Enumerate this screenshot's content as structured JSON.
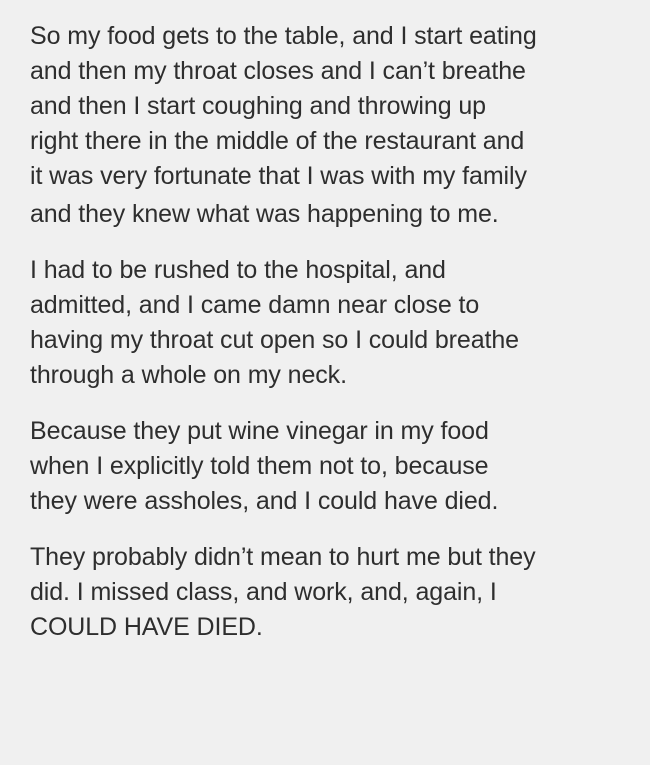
{
  "post": {
    "paragraphs": [
      {
        "lines": [
          "So my food gets to the table, and I start eating",
          "and then my throat closes and I can’t breathe",
          "and then I start coughing and throwing up",
          "right there in the middle of the restaurant and",
          "it was very fortunate that I was with my family",
          "and they knew what was happening to me."
        ]
      },
      {
        "lines": [
          "I had to be rushed to the hospital, and",
          "admitted, and I came damn near close to",
          "having my throat cut open so I could breathe",
          "through a whole on my neck."
        ]
      },
      {
        "lines": [
          "Because they put wine vinegar in my food",
          "when I explicitly told them not to, because",
          "they were assholes, and I could have died."
        ]
      },
      {
        "lines": [
          "They probably didn’t mean to hurt me but they",
          "did. I missed class, and work, and, again, I",
          "COULD HAVE DIED."
        ]
      }
    ]
  }
}
